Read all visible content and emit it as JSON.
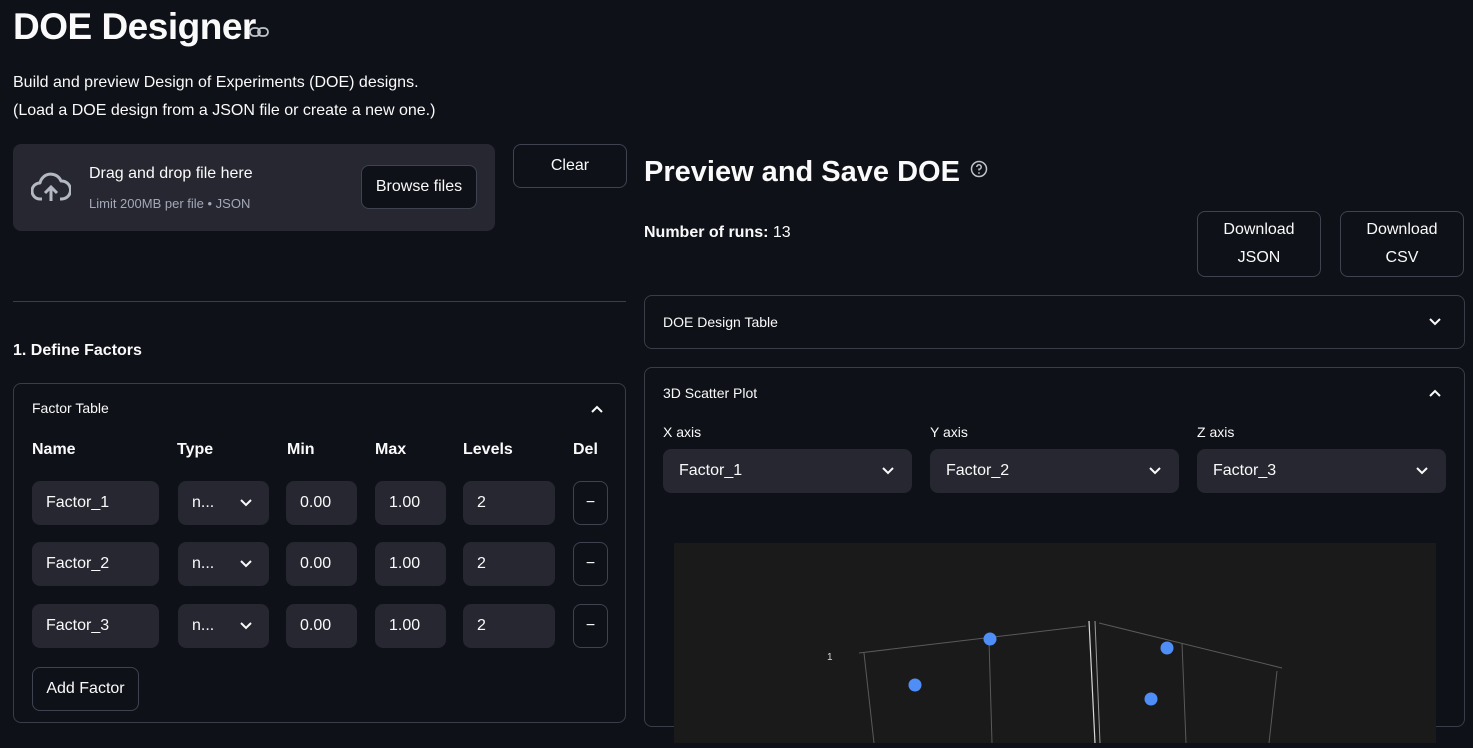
{
  "header": {
    "title": "DOE Designer",
    "description_line1": "Build and preview Design of Experiments (DOE) designs.",
    "description_line2": "(Load a DOE design from a JSON file or create a new one.)"
  },
  "uploader": {
    "drop_text": "Drag and drop file here",
    "limit_text": "Limit 200MB per file • JSON",
    "browse_label": "Browse files"
  },
  "clear_label": "Clear",
  "factors": {
    "section_title": "1. Define Factors",
    "panel_title": "Factor Table",
    "columns": [
      "Name",
      "Type",
      "Min",
      "Max",
      "Levels",
      "Del"
    ],
    "rows": [
      {
        "name": "Factor_1",
        "type": "n...",
        "min": "0.00",
        "max": "1.00",
        "levels": "2",
        "del": "−"
      },
      {
        "name": "Factor_2",
        "type": "n...",
        "min": "0.00",
        "max": "1.00",
        "levels": "2",
        "del": "−"
      },
      {
        "name": "Factor_3",
        "type": "n...",
        "min": "0.00",
        "max": "1.00",
        "levels": "2",
        "del": "−"
      }
    ],
    "add_label": "Add Factor"
  },
  "preview": {
    "title": "Preview and Save DOE",
    "runs_label": "Number of runs:",
    "runs_value": "13",
    "download_json": [
      "Download",
      "JSON"
    ],
    "download_csv": [
      "Download",
      "CSV"
    ],
    "design_table_title": "DOE Design Table",
    "scatter_title": "3D Scatter Plot",
    "x_axis_label": "X axis",
    "y_axis_label": "Y axis",
    "z_axis_label": "Z axis",
    "x_axis_value": "Factor_1",
    "y_axis_value": "Factor_2",
    "z_axis_value": "Factor_3",
    "plot_tick_label": "1"
  },
  "colors": {
    "background": "#0e1117",
    "widget": "#262730",
    "point": "#4f8ef7"
  }
}
